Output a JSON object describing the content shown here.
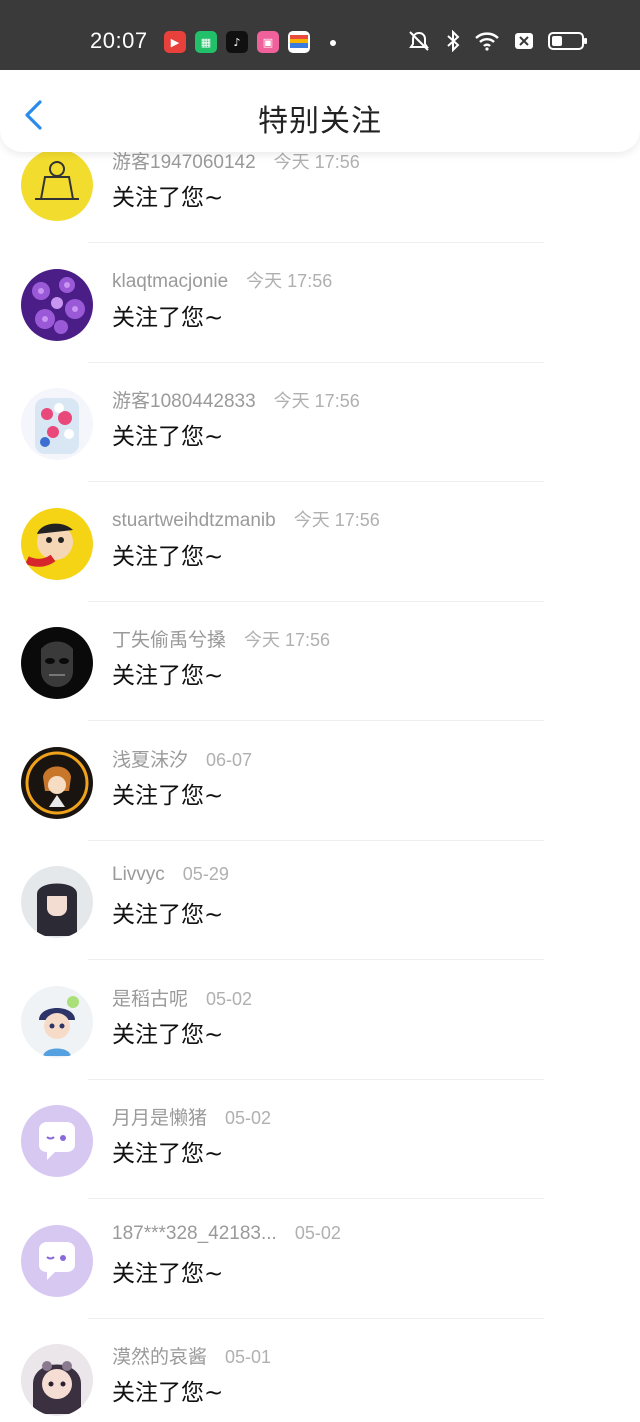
{
  "status_bar": {
    "time": "20:07",
    "app_icons": [
      "video-app-icon",
      "store-app-icon",
      "tiktok-app-icon",
      "bilibili-app-icon",
      "wallet-app-icon"
    ],
    "system_icons": [
      "mute-bell-icon",
      "bluetooth-icon",
      "wifi-icon",
      "sim-off-icon",
      "battery-icon"
    ]
  },
  "header": {
    "title": "特别关注",
    "back_icon": "chevron-left-icon",
    "accent_color": "#2a8bea"
  },
  "items": [
    {
      "username": "游客1947060142",
      "time": "今天 17:56",
      "message": "关注了您~",
      "avatar": "cartoon-yellow"
    },
    {
      "username": "klaqtmacjonie",
      "time": "今天 17:56",
      "message": "关注了您~",
      "avatar": "purple-flowers"
    },
    {
      "username": "游客1080442833",
      "time": "今天 17:56",
      "message": "关注了您~",
      "avatar": "flower-jar"
    },
    {
      "username": "stuartweihdtzmanib",
      "time": "今天 17:56",
      "message": "关注了您~",
      "avatar": "shinchan"
    },
    {
      "username": "丁失偷禹兮搡",
      "time": "今天 17:56",
      "message": "关注了您~",
      "avatar": "dark-mask"
    },
    {
      "username": "浅夏沫汐",
      "time": "06-07",
      "message": "关注了您~",
      "avatar": "anime-boy"
    },
    {
      "username": "Livvyc",
      "time": "05-29",
      "message": "关注了您~",
      "avatar": "anime-girl"
    },
    {
      "username": "是稻古呢",
      "time": "05-02",
      "message": "关注了您~",
      "avatar": "chibi-boy"
    },
    {
      "username": "月月是懒猪",
      "time": "05-02",
      "message": "关注了您~",
      "avatar": "default-chat"
    },
    {
      "username": "187***328_42183...",
      "time": "05-02",
      "message": "关注了您~",
      "avatar": "default-chat"
    },
    {
      "username": "漠然的哀酱",
      "time": "05-01",
      "message": "关注了您~",
      "avatar": "anime-girl-dark"
    }
  ]
}
